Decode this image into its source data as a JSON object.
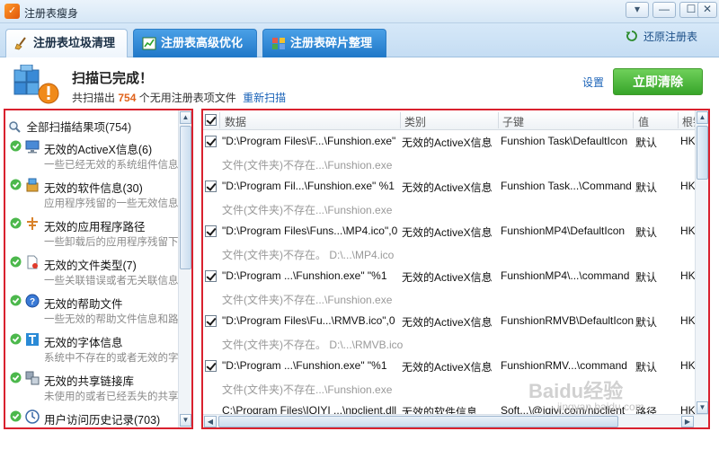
{
  "window": {
    "title": "注册表瘦身",
    "controls": {
      "menu": "▾",
      "minimize": "—",
      "maximize": "☐",
      "close": "✕"
    }
  },
  "tabs": [
    {
      "label": "注册表垃圾清理",
      "active": true
    },
    {
      "label": "注册表高级优化",
      "active": false
    },
    {
      "label": "注册表碎片整理",
      "active": false
    }
  ],
  "restore_label": "还原注册表",
  "status": {
    "title": "扫描已完成！",
    "sub_prefix": "共扫描出",
    "count": "754",
    "sub_suffix": "个无用注册表项文件",
    "rescan": "重新扫描",
    "settings": "设置",
    "clean_button": "立即清除"
  },
  "left_panel": {
    "all_results": "全部扫描结果项(754)",
    "items": [
      {
        "name": "无效的ActiveX信息(6)",
        "desc": "一些已经无效的系统组件信息",
        "icon": "monitor-icon"
      },
      {
        "name": "无效的软件信息(30)",
        "desc": "应用程序残留的一些无效信息",
        "icon": "software-box-icon"
      },
      {
        "name": "无效的应用程序路径",
        "desc": "一些卸载后的应用程序残留下",
        "icon": "app-path-icon"
      },
      {
        "name": "无效的文件类型(7)",
        "desc": "一些关联错误或者无关联信息",
        "icon": "file-type-icon"
      },
      {
        "name": "无效的帮助文件",
        "desc": "一些无效的帮助文件信息和路",
        "icon": "help-icon"
      },
      {
        "name": "无效的字体信息",
        "desc": "系统中不存在的或者无效的字",
        "icon": "font-icon"
      },
      {
        "name": "无效的共享链接库",
        "desc": "未使用的或者已经丢失的共享",
        "icon": "shared-library-icon"
      },
      {
        "name": "用户访问历史记录(703)",
        "desc": "",
        "icon": "history-icon"
      }
    ]
  },
  "table": {
    "columns": [
      "数据",
      "类别",
      "子键",
      "值",
      "根键"
    ],
    "rows": [
      {
        "data": "\"D:\\Program Files\\F...\\Funshion.exe\"",
        "category": "无效的ActiveX信息",
        "subkey": "Funshion Task\\DefaultIcon",
        "value": "默认",
        "root": "HKEY",
        "note": "文件(文件夹)不存在...\\Funshion.exe"
      },
      {
        "data": "\"D:\\Program Fil...\\Funshion.exe\" %1",
        "category": "无效的ActiveX信息",
        "subkey": "Funshion Task...\\Command",
        "value": "默认",
        "root": "HKEY",
        "note": "文件(文件夹)不存在...\\Funshion.exe"
      },
      {
        "data": "\"D:\\Program Files\\Funs...\\MP4.ico\",0",
        "category": "无效的ActiveX信息",
        "subkey": "FunshionMP4\\DefaultIcon",
        "value": "默认",
        "root": "HKEY",
        "note": "文件(文件夹)不存在。 D:\\...\\MP4.ico"
      },
      {
        "data": "\"D:\\Program ...\\Funshion.exe\" \"%1",
        "category": "无效的ActiveX信息",
        "subkey": "FunshionMP4\\...\\command",
        "value": "默认",
        "root": "HKEY",
        "note": "文件(文件夹)不存在...\\Funshion.exe"
      },
      {
        "data": "\"D:\\Program Files\\Fu...\\RMVB.ico\",0",
        "category": "无效的ActiveX信息",
        "subkey": "FunshionRMVB\\DefaultIcon",
        "value": "默认",
        "root": "HKEY",
        "note": "文件(文件夹)不存在。 D:\\...\\RMVB.ico"
      },
      {
        "data": "\"D:\\Program ...\\Funshion.exe\" \"%1",
        "category": "无效的ActiveX信息",
        "subkey": "FunshionRMV...\\command",
        "value": "默认",
        "root": "HKEY",
        "note": "文件(文件夹)不存在...\\Funshion.exe"
      }
    ],
    "partial_row": {
      "data": "C:\\Program Files\\IQIYI ...\\npclient.dll",
      "category": "无效的软件信息",
      "subkey": "Soft...\\@iqiyi.com/npclient",
      "value": "路径",
      "root": "HKEY"
    }
  },
  "watermark": {
    "text": "Baidu经验",
    "sub": "jingyan.baidu.com"
  }
}
